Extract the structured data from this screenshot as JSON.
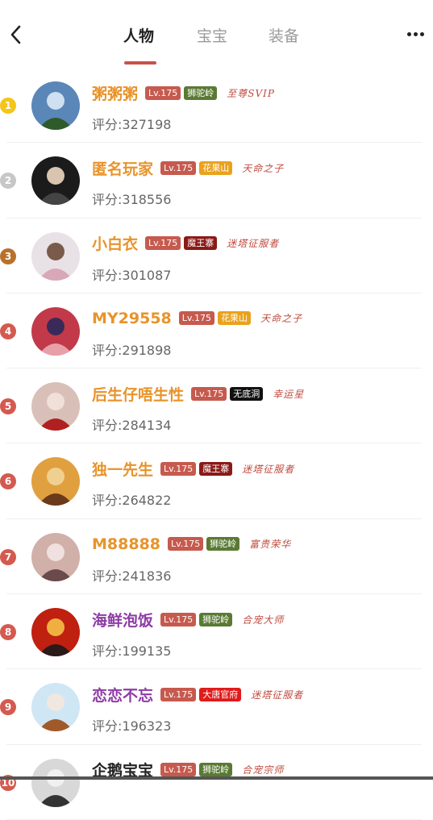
{
  "header": {
    "tabs": [
      {
        "label": "人物",
        "active": true
      },
      {
        "label": "宝宝",
        "active": false
      },
      {
        "label": "装备",
        "active": false
      }
    ],
    "back_icon": "chevron-left-icon",
    "more_icon": "more-dots-icon"
  },
  "colors": {
    "accent": "#c9514a",
    "gold_name": "#e8932a",
    "purple_name": "#8e3ca6",
    "dark_name": "#222222",
    "rank1": "#f5c518",
    "rank2": "#c7c7c7",
    "rank3": "#b8712d",
    "rank_other": "#d45a4f"
  },
  "players": [
    {
      "rank": "1",
      "name": "粥粥粥",
      "level": "Lv.175",
      "school": "狮驼岭",
      "title": "至尊SVIP",
      "score": "评分:327198"
    },
    {
      "rank": "2",
      "name": "匿名玩家",
      "level": "Lv.175",
      "school": "花果山",
      "title": "天命之子",
      "score": "评分:318556"
    },
    {
      "rank": "3",
      "name": "小白衣",
      "level": "Lv.175",
      "school": "魔王寨",
      "title": "迷塔征服者",
      "score": "评分:301087"
    },
    {
      "rank": "4",
      "name": "MY29558",
      "level": "Lv.175",
      "school": "花果山",
      "title": "天命之子",
      "score": "评分:291898"
    },
    {
      "rank": "5",
      "name": "后生仔唔生性",
      "level": "Lv.175",
      "school": "无底洞",
      "title": "幸运星",
      "score": "评分:284134"
    },
    {
      "rank": "6",
      "name": "独一先生",
      "level": "Lv.175",
      "school": "魔王寨",
      "title": "迷塔征服者",
      "score": "评分:264822"
    },
    {
      "rank": "7",
      "name": "M88888",
      "level": "Lv.175",
      "school": "狮驼岭",
      "title": "富贵荣华",
      "score": "评分:241836"
    },
    {
      "rank": "8",
      "name": "海鲜泡饭",
      "level": "Lv.175",
      "school": "狮驼岭",
      "title": "合宠大师",
      "score": "评分:199135"
    },
    {
      "rank": "9",
      "name": "恋恋不忘",
      "level": "Lv.175",
      "school": "大唐官府",
      "title": "迷塔征服者",
      "score": "评分:196323"
    },
    {
      "rank": "10",
      "name": "企鹅宝宝",
      "level": "Lv.175",
      "school": "狮驼岭",
      "title": "合宠宗师",
      "score": ""
    }
  ]
}
